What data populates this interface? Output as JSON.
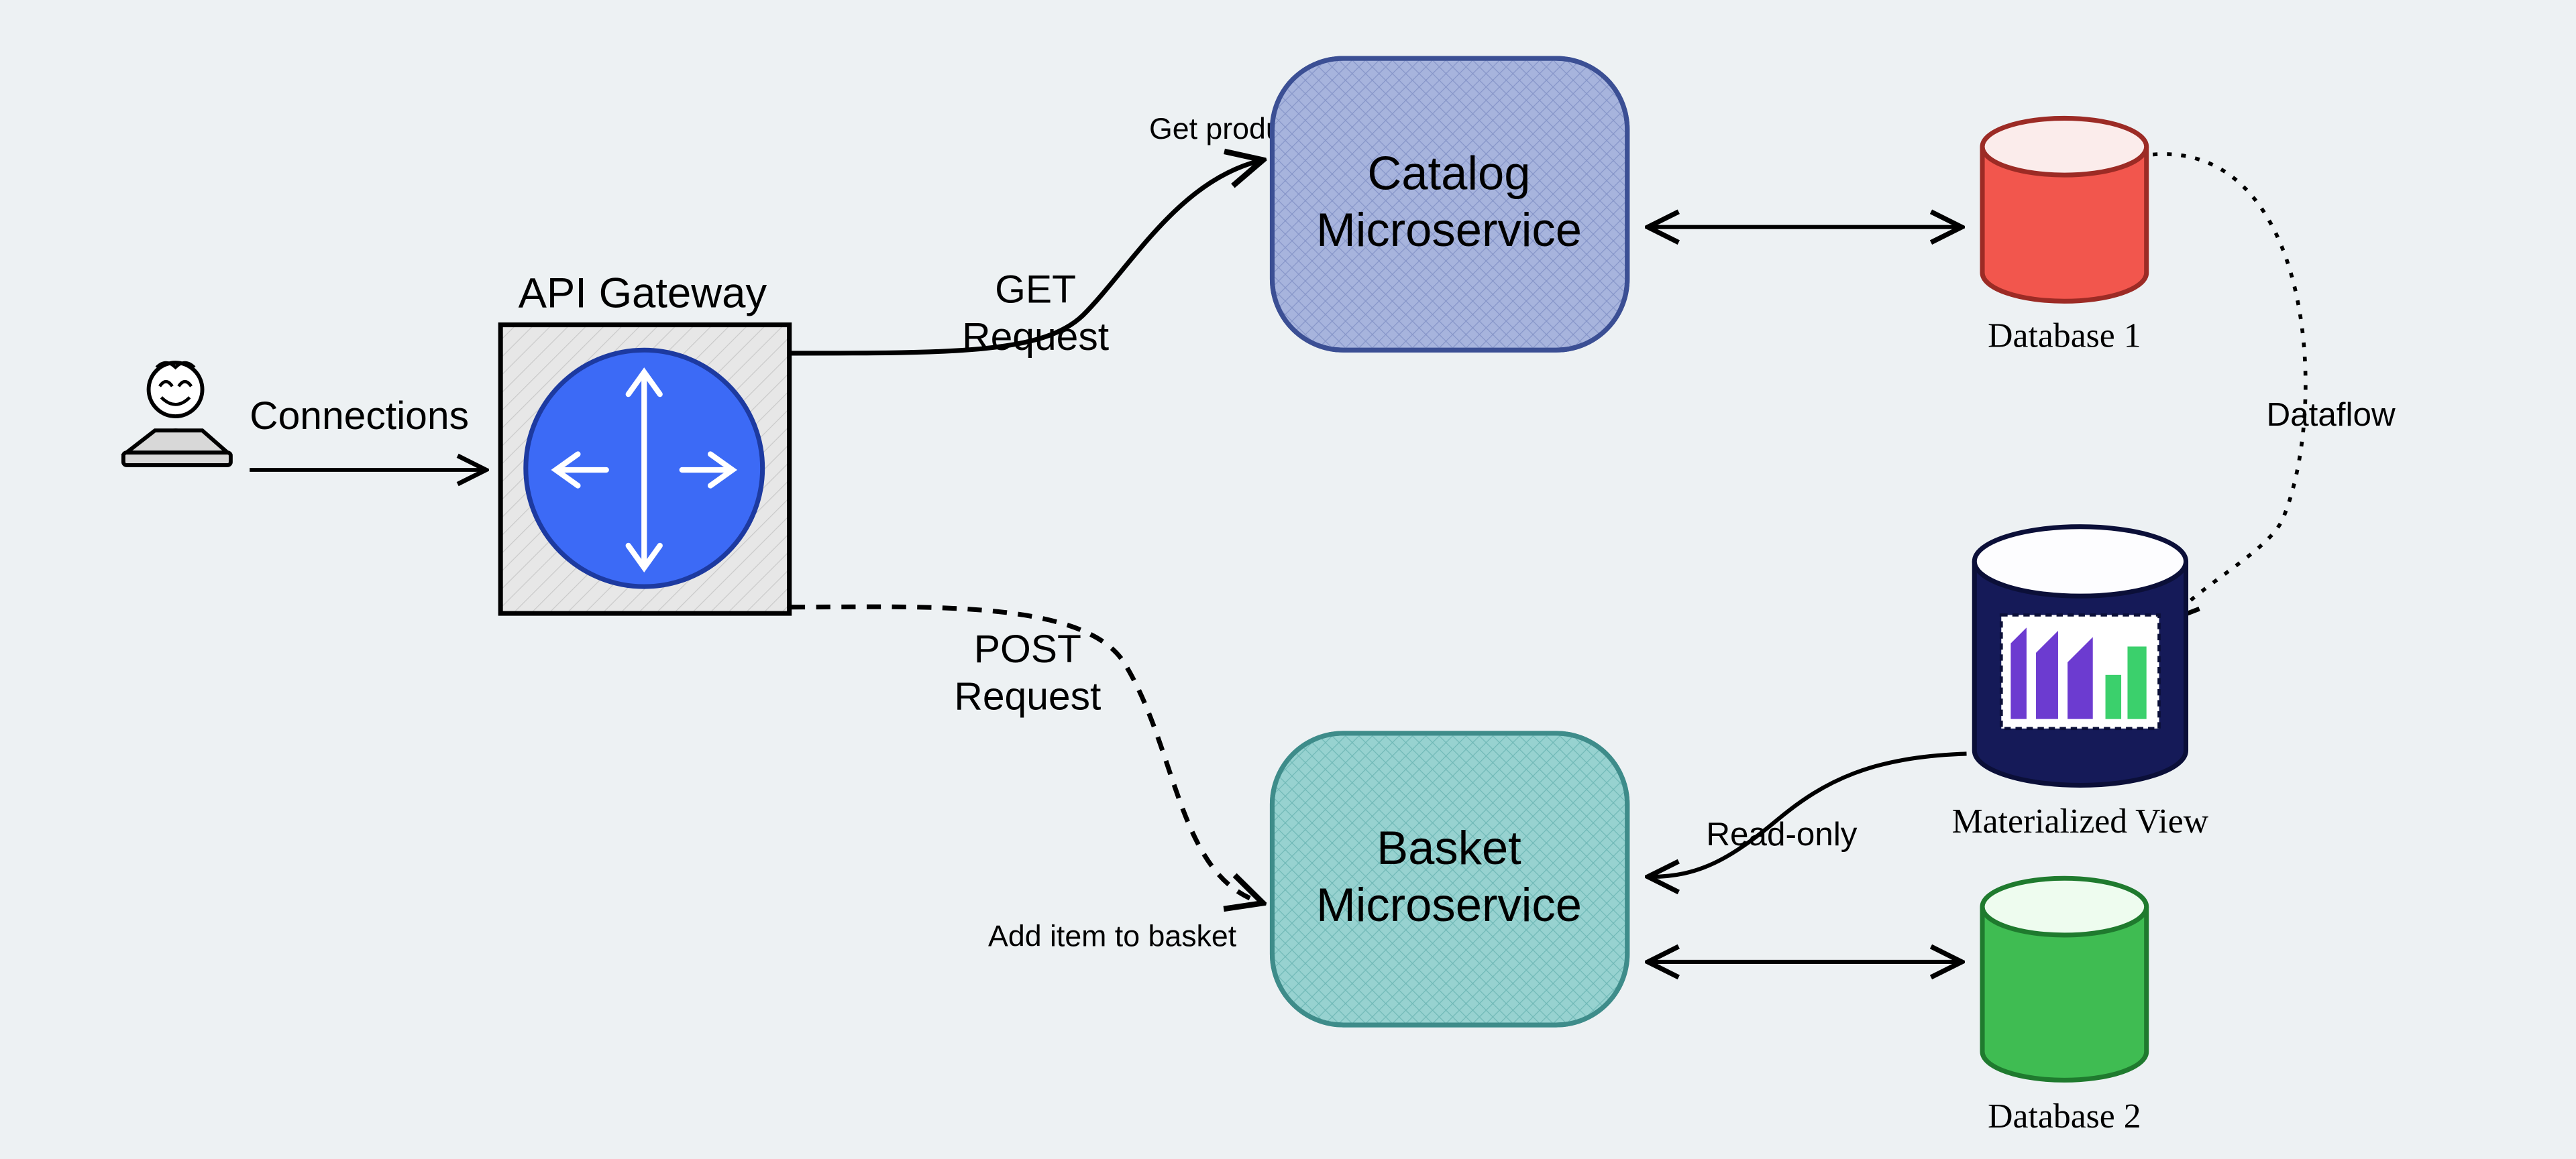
{
  "nodes": {
    "user": {
      "label": ""
    },
    "gateway": {
      "label": "API Gateway"
    },
    "catalog": {
      "line1": "Catalog",
      "line2": "Microservice"
    },
    "basket": {
      "line1": "Basket",
      "line2": "Microservice"
    },
    "db1": {
      "label": "Database 1"
    },
    "db2": {
      "label": "Database 2"
    },
    "matview": {
      "label": "Materialized View"
    }
  },
  "edges": {
    "connections": {
      "label": "Connections"
    },
    "get_request": {
      "line1": "GET",
      "line2": "Request",
      "target_label": "Get products"
    },
    "post_request": {
      "line1": "POST",
      "line2": "Request",
      "target_label": "Add item to basket"
    },
    "catalog_db": {
      "label": ""
    },
    "basket_db": {
      "label": ""
    },
    "readonly": {
      "label": "Read-only"
    },
    "dataflow": {
      "label": "Dataflow"
    }
  },
  "colors": {
    "bg": "#edf1f3",
    "gateway_fill": "#e7e7e7",
    "gateway_circle": "#3c6af6",
    "catalog_fill": "#9aa9d4",
    "basket_fill": "#87c8c7",
    "db1_fill": "#f2564d",
    "db2_fill": "#3fbc52",
    "matview_fill": "#151a58",
    "matview_logo1": "#6c3bd0",
    "matview_logo2": "#3bd06c"
  }
}
